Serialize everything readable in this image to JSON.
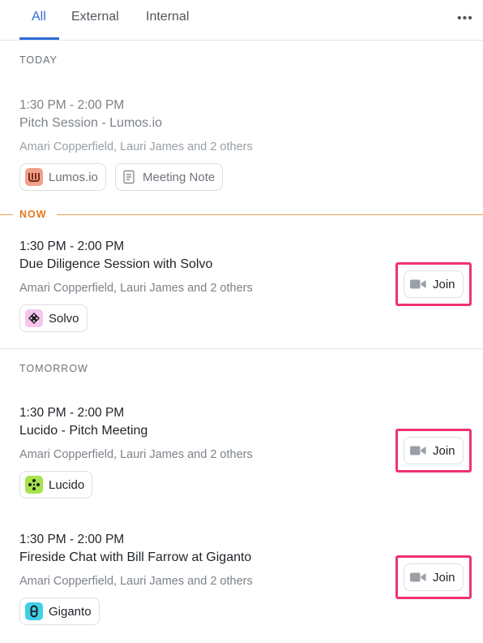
{
  "tabs": {
    "all": "All",
    "external": "External",
    "internal": "Internal",
    "more": "•••"
  },
  "sections": {
    "today": "TODAY",
    "now": "NOW",
    "tomorrow": "TOMORROW"
  },
  "events": [
    {
      "time": "1:30 PM - 2:00 PM",
      "title": "Pitch Session - Lumos.io",
      "people": "Amari Copperfield, Lauri James and 2 others",
      "company": "Lumos.io",
      "note": "Meeting Note"
    },
    {
      "time": "1:30 PM - 2:00 PM",
      "title": "Due Diligence Session with Solvo",
      "people": "Amari Copperfield, Lauri James and 2 others",
      "company": "Solvo",
      "join": "Join"
    },
    {
      "time": "1:30 PM - 2:00 PM",
      "title": "Lucido - Pitch Meeting",
      "people": "Amari Copperfield, Lauri James and 2 others",
      "company": "Lucido",
      "join": "Join"
    },
    {
      "time": "1:30 PM - 2:00 PM",
      "title": "Fireside Chat with Bill Farrow at Giganto",
      "people": "Amari Copperfield, Lauri James and 2 others",
      "company": "Giganto",
      "join": "Join"
    }
  ],
  "colors": {
    "accent": "#2f6bd8",
    "now": "#e07a1f",
    "highlight": "#f0326e",
    "lumos_logo": "#f0a08a",
    "solvo_logo": "#f6c6ee",
    "lucido_logo": "#a6e34d",
    "giganto_logo": "#3fd0e8"
  },
  "icons": {
    "more": "more-horizontal-icon",
    "video": "video-camera-icon",
    "note": "document-icon"
  }
}
